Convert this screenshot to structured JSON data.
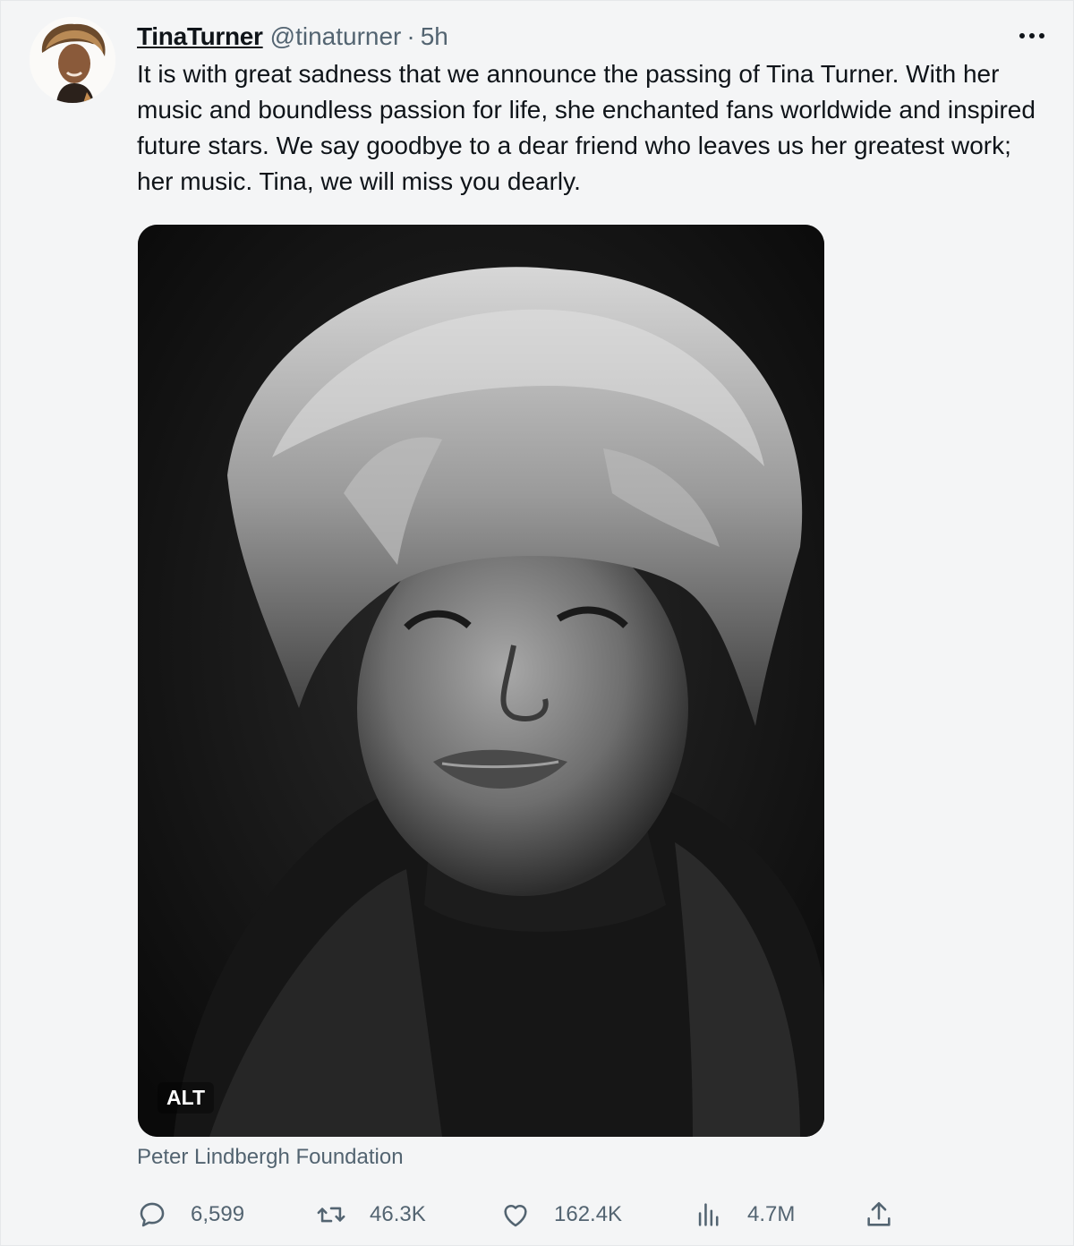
{
  "tweet": {
    "display_name": "TinaTurner",
    "handle": "@tinaturner",
    "separator": "·",
    "time": "5h",
    "text": "It is with great sadness that we announce the passing of Tina Turner. With her music and boundless passion for life, she enchanted fans worldwide and inspired future stars. We say goodbye to a dear friend who leaves us her greatest work; her music. Tina, we will miss you dearly.",
    "media": {
      "alt_badge": "ALT",
      "credit": "Peter Lindbergh Foundation"
    },
    "actions": {
      "reply": {
        "icon": "reply-icon",
        "count": "6,599"
      },
      "retweet": {
        "icon": "retweet-icon",
        "count": "46.3K"
      },
      "like": {
        "icon": "heart-icon",
        "count": "162.4K"
      },
      "views": {
        "icon": "analytics-icon",
        "count": "4.7M"
      },
      "share": {
        "icon": "share-icon"
      }
    }
  },
  "colors": {
    "background": "#f4f5f6",
    "text_primary": "#0f1419",
    "text_secondary": "#536471"
  }
}
